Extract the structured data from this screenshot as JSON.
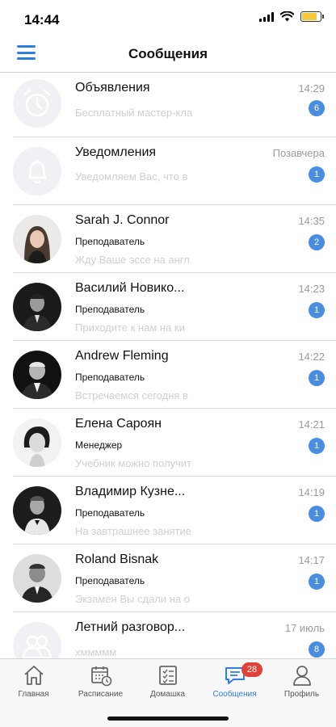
{
  "status_bar": {
    "time": "14:44",
    "battery_level": 0.8,
    "battery_color": "#f5c93b"
  },
  "header": {
    "title": "Сообщения",
    "accent_color": "#2f7fe0"
  },
  "chats": [
    {
      "name": "Объявления",
      "role": "",
      "preview": "Бесплатный мастер-кла",
      "time": "14:29",
      "unread": "6",
      "avatar": "alarm-clock-icon"
    },
    {
      "name": "Уведомления",
      "role": "",
      "preview": "Уведомляем Вас, что в",
      "time": "Позавчера",
      "unread": "1",
      "avatar": "bell-icon"
    },
    {
      "name": "Sarah J. Connor",
      "role": "Преподаватель",
      "preview": "Жду Ваше эссе на англ",
      "time": "14:35",
      "unread": "2",
      "avatar": "user-photo"
    },
    {
      "name": "Василий  Новико...",
      "role": "Преподаватель",
      "preview": "Приходите к нам на ки",
      "time": "14:23",
      "unread": "1",
      "avatar": "user-photo"
    },
    {
      "name": "Andrew  Fleming",
      "role": "Преподаватель",
      "preview": "Встречаемся сегодня в",
      "time": "14:22",
      "unread": "1",
      "avatar": "user-photo"
    },
    {
      "name": "Елена  Сароян",
      "role": "Менеджер",
      "preview": "Учебник можно получит",
      "time": "14:21",
      "unread": "1",
      "avatar": "user-photo"
    },
    {
      "name": "Владимир  Кузне...",
      "role": "Преподаватель",
      "preview": "На завтрашнее занятие",
      "time": "14:19",
      "unread": "1",
      "avatar": "user-photo"
    },
    {
      "name": "Roland  Bisnak",
      "role": "Преподаватель",
      "preview": "Экзамен Вы сдали на о",
      "time": "14:17",
      "unread": "1",
      "avatar": "user-photo"
    },
    {
      "name": "Летний разговор...",
      "role": "",
      "preview": "хммммм",
      "time": "17 июль",
      "unread": "8",
      "avatar": "group-icon"
    }
  ],
  "tabs": [
    {
      "label": "Главная",
      "icon": "home-icon"
    },
    {
      "label": "Расписание",
      "icon": "calendar-icon"
    },
    {
      "label": "Домашка",
      "icon": "checklist-icon"
    },
    {
      "label": "Сообщения",
      "icon": "chat-icon",
      "badge": "28",
      "active": true
    },
    {
      "label": "Профиль",
      "icon": "person-icon"
    }
  ]
}
